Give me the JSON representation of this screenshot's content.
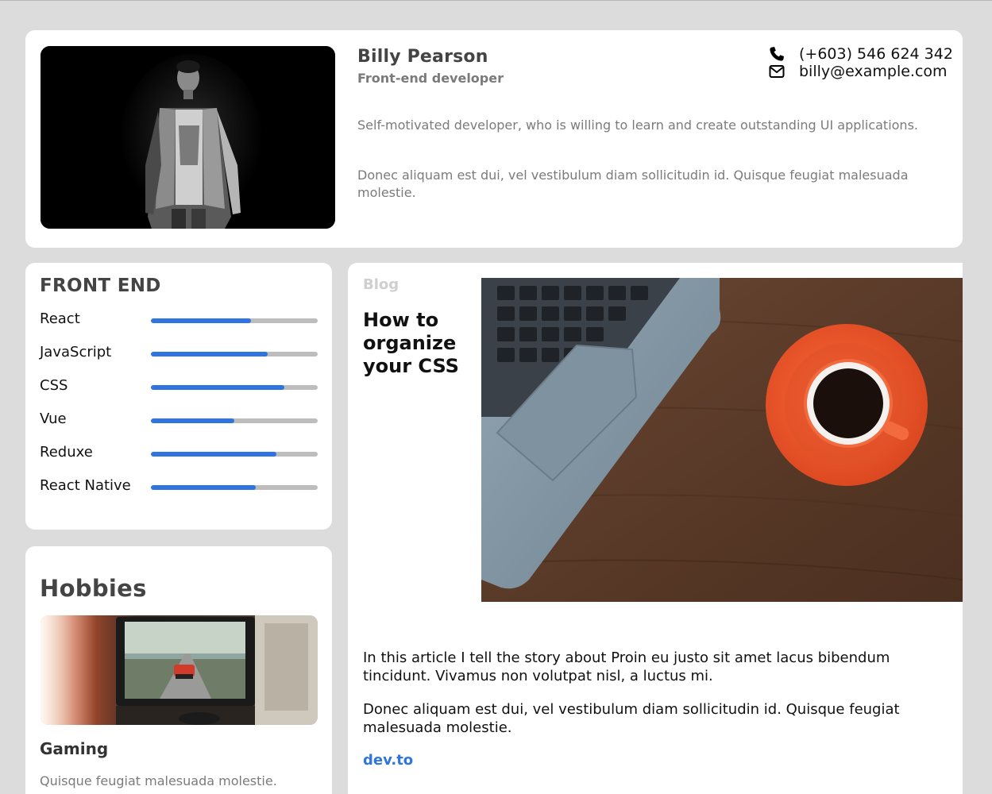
{
  "profile": {
    "name": "Billy Pearson",
    "role": "Front-end developer",
    "bio": [
      "Self-motivated developer, who is willing to learn and create outstanding UI applications.",
      "Donec aliquam est dui, vel vestibulum diam sollicitudin id. Quisque feugiat malesuada molestie."
    ],
    "phone": "(+603) 546 624 342",
    "email": "billy@example.com",
    "phone_icon": "phone-icon",
    "email_icon": "envelope-icon"
  },
  "skills": {
    "title": "FRONT END",
    "items": [
      {
        "label": "React",
        "level": 0.6
      },
      {
        "label": "JavaScript",
        "level": 0.7
      },
      {
        "label": "CSS",
        "level": 0.8
      },
      {
        "label": "Vue",
        "level": 0.5
      },
      {
        "label": "Reduxe",
        "level": 0.75
      },
      {
        "label": "React Native",
        "level": 0.63
      }
    ]
  },
  "hobbies": {
    "title": "Hobbies",
    "items": [
      {
        "name": "Gaming",
        "description": "Quisque feugiat malesuada molestie."
      }
    ]
  },
  "blog": {
    "tag": "Blog",
    "title": "How to organize your CSS",
    "paragraphs": [
      "In this article I tell the story about Proin eu justo sit amet lacus bibendum tincidunt. Vivamus non volutpat nisl, a luctus mi.",
      "Donec aliquam est dui, vel vestibulum diam sollicitudin id. Quisque feugiat malesuada molestie."
    ],
    "link_text": "dev.to"
  },
  "colors": {
    "accent": "#2f74e0",
    "background": "#dcdcdc",
    "bar_track": "#bdbdbd"
  }
}
